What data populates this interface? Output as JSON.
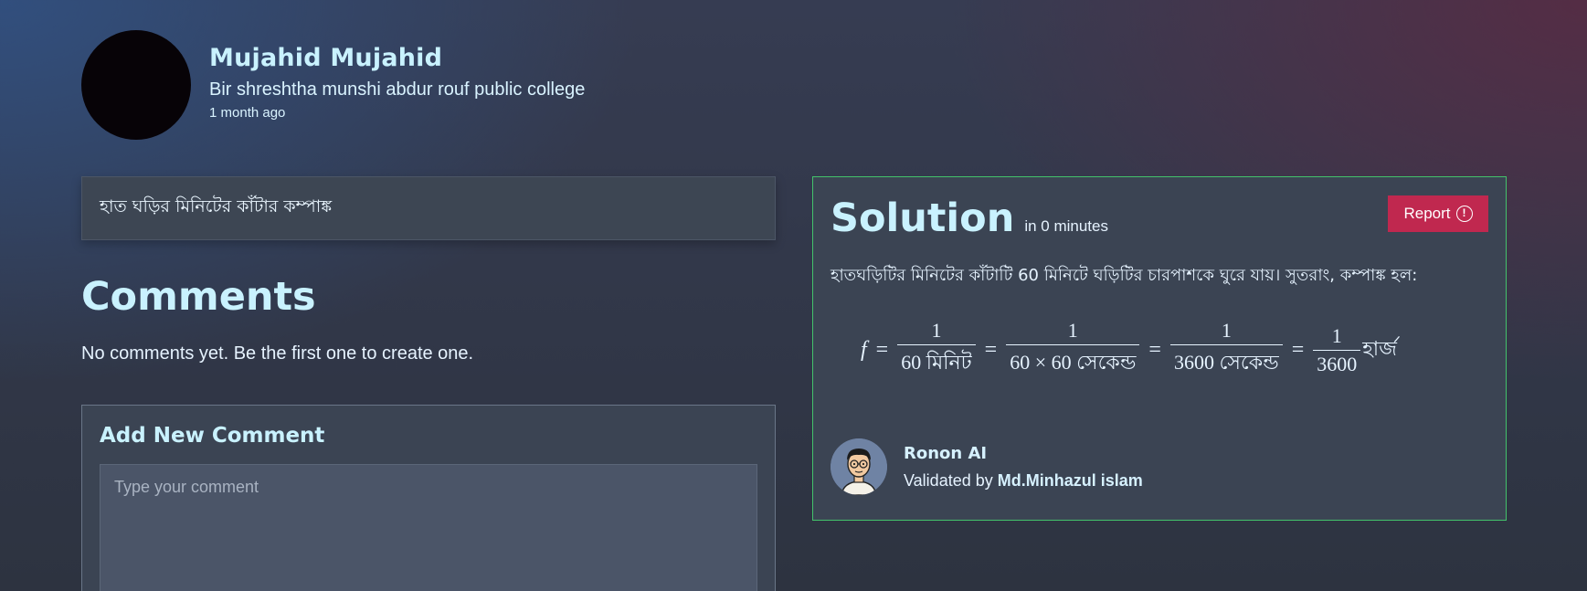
{
  "post": {
    "author_name": "Mujahid Mujahid",
    "school": "Bir shreshtha munshi abdur rouf public college",
    "time_ago": "1 month ago",
    "question": "হাত ঘড়ির মিনিটের কাঁটার কম্পাঙ্ক"
  },
  "comments": {
    "title": "Comments",
    "empty_text": "No comments yet. Be the first one to create one.",
    "add_title": "Add New Comment",
    "input_placeholder": "Type your comment",
    "input_value": ""
  },
  "solution": {
    "title": "Solution",
    "time": "in 0 minutes",
    "report_label": "Report",
    "text": "হাতঘড়িটির মিনিটের কাঁটাটি 60 মিনিটে ঘড়িটির চারপাশকে ঘুরে যায়। সুতরাং, কম্পাঙ্ক হল:",
    "formula": {
      "lhs": "f",
      "eq": "=",
      "times": "×",
      "f1_num": "1",
      "f1_den": "60 মিনিট",
      "f2_num": "1",
      "f2_den_a": "60",
      "f2_den_b": "60 সেকেন্ড",
      "f3_num": "1",
      "f3_den": "3600 সেকেন্ড",
      "f4_num": "1",
      "f4_den": "3600",
      "unit": "হার্জ"
    },
    "author": {
      "name": "Ronon AI",
      "validated_prefix": "Validated by",
      "validator": "Md.Minhazul islam"
    }
  },
  "colors": {
    "accent_heading": "#c9f2ff",
    "report_button": "#c0284f",
    "solution_border": "#43c26b",
    "card_bg": "#3b4453"
  },
  "icons": {
    "report": "info-circle-icon",
    "bot_avatar": "cartoon-avatar-icon"
  }
}
